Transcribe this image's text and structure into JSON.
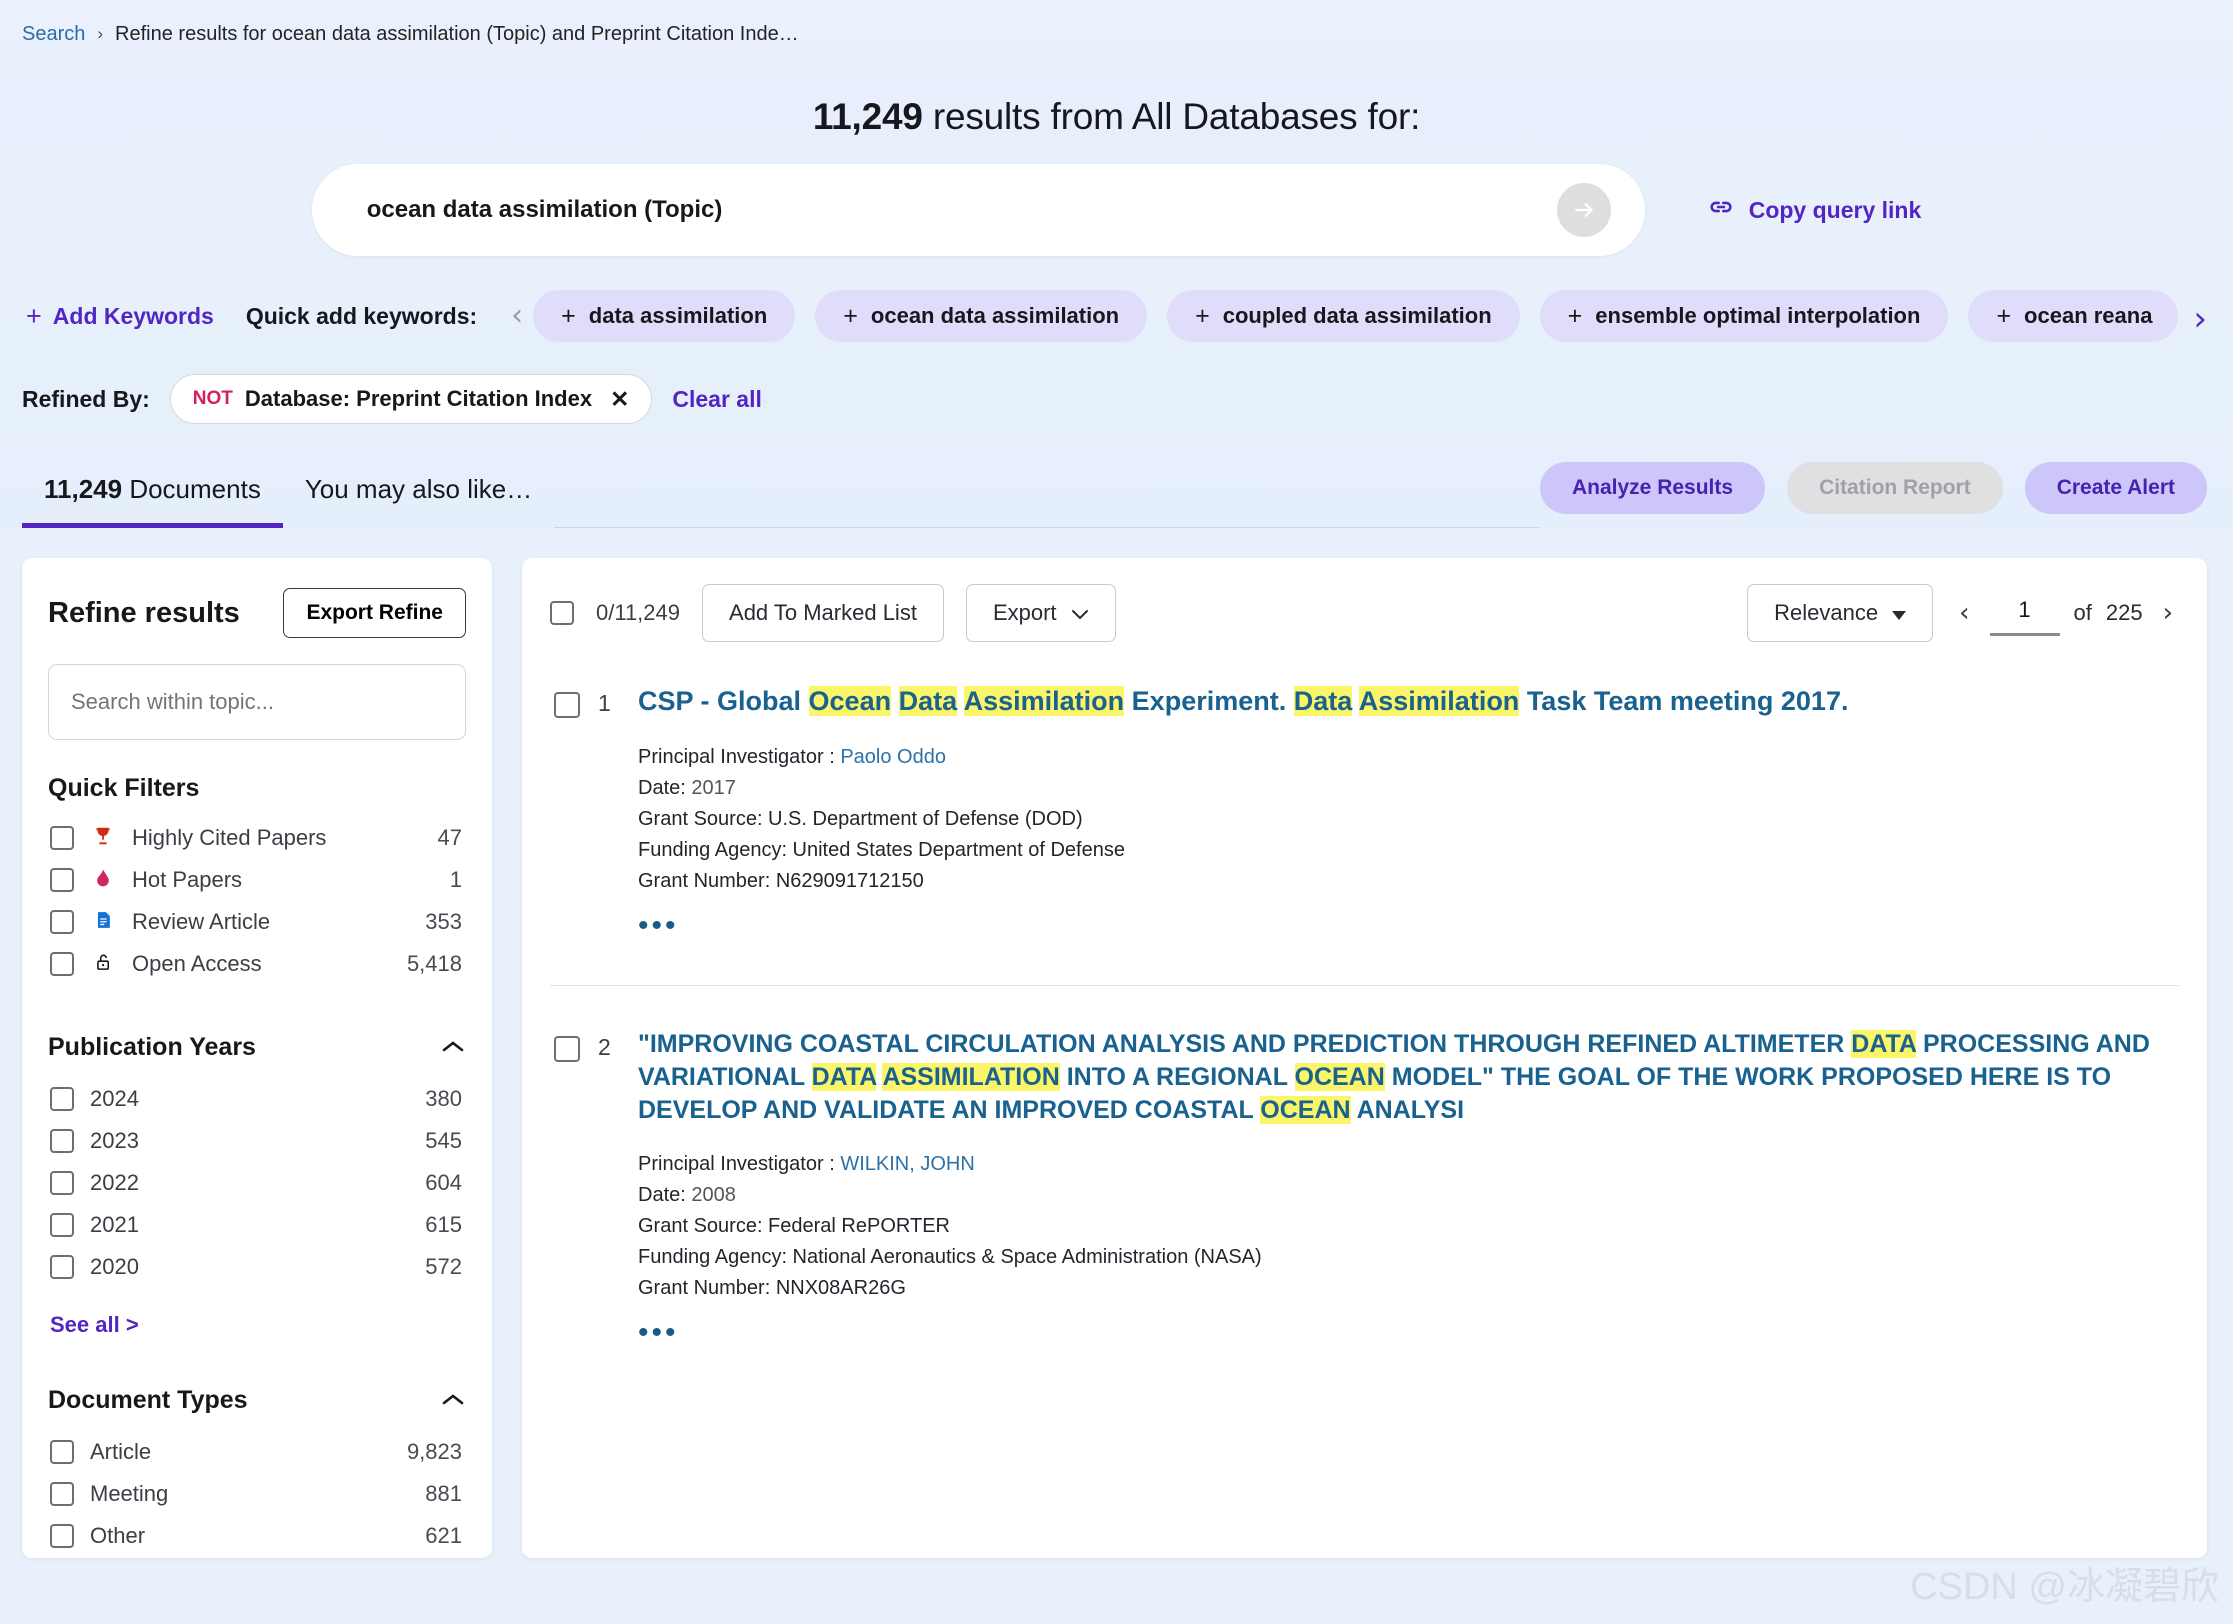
{
  "breadcrumb": {
    "root": "Search",
    "separator": "›",
    "current": "Refine results for ocean data assimilation (Topic) and Preprint Citation Inde…"
  },
  "hero": {
    "count": "11,249",
    "title_rest": " results from All Databases for:",
    "query": "ocean data assimilation (Topic)",
    "go_icon": "arrow-right-icon",
    "copy_query_link": "Copy query link",
    "link_icon": "link-icon"
  },
  "keywords": {
    "add_keywords": "Add Keywords",
    "quick_add_label": "Quick add keywords:",
    "prev_icon": "chevron-left-icon",
    "next_icon": "chevron-right-icon",
    "chips": [
      "data assimilation",
      "ocean data assimilation",
      "coupled data assimilation",
      "ensemble optimal interpolation",
      "ocean reana"
    ]
  },
  "refined": {
    "label": "Refined By:",
    "chip_not": "NOT",
    "chip_label": "Database: Preprint Citation Index",
    "chip_close": "✕",
    "clear_all": "Clear all"
  },
  "tabs": {
    "documents_count": "11,249",
    "documents_label": " Documents",
    "also_like": "You may also like…",
    "active_index": 0
  },
  "actions": {
    "analyze": "Analyze Results",
    "citation_report": "Citation Report",
    "create_alert": "Create Alert"
  },
  "sidebar": {
    "title": "Refine results",
    "export_refine": "Export Refine",
    "search_placeholder": "Search within topic...",
    "quick_filters_title": "Quick Filters",
    "quick_filters": [
      {
        "icon": "trophy-icon",
        "glyph": "\u0000",
        "label": "Highly Cited Papers",
        "count": "47"
      },
      {
        "icon": "flame-icon",
        "glyph": "\u0000",
        "label": "Hot Papers",
        "count": "1"
      },
      {
        "icon": "document-icon",
        "glyph": "\u0000",
        "label": "Review Article",
        "count": "353"
      },
      {
        "icon": "unlock-icon",
        "glyph": "\u0000",
        "label": "Open Access",
        "count": "5,418"
      }
    ],
    "publication_years": {
      "title": "Publication Years",
      "collapse_icon": "chevron-up-icon",
      "items": [
        {
          "label": "2024",
          "count": "380"
        },
        {
          "label": "2023",
          "count": "545"
        },
        {
          "label": "2022",
          "count": "604"
        },
        {
          "label": "2021",
          "count": "615"
        },
        {
          "label": "2020",
          "count": "572"
        }
      ],
      "see_all": "See all >"
    },
    "document_types": {
      "title": "Document Types",
      "collapse_icon": "chevron-up-icon",
      "items": [
        {
          "label": "Article",
          "count": "9,823"
        },
        {
          "label": "Meeting",
          "count": "881"
        },
        {
          "label": "Other",
          "count": "621"
        }
      ]
    }
  },
  "results_toolbar": {
    "select_count": "0/11,249",
    "add_to_marked_list": "Add To Marked List",
    "export": "Export",
    "export_caret": "chevron-down-icon",
    "sort_value": "Relevance",
    "sort_caret": "caret-down-icon",
    "prev_icon": "chevron-left-icon",
    "next_icon": "chevron-right-icon",
    "page_value": "1",
    "page_of": "of",
    "page_total": "225"
  },
  "records": [
    {
      "number": "1",
      "title_parts": [
        {
          "t": "CSP - Global ",
          "hl": false
        },
        {
          "t": "Ocean",
          "hl": true
        },
        {
          "t": " ",
          "hl": false
        },
        {
          "t": "Data",
          "hl": true
        },
        {
          "t": " ",
          "hl": false
        },
        {
          "t": "Assimilation",
          "hl": true
        },
        {
          "t": " Experiment. ",
          "hl": false
        },
        {
          "t": "Data",
          "hl": true
        },
        {
          "t": " ",
          "hl": false
        },
        {
          "t": "Assimilation",
          "hl": true
        },
        {
          "t": " Task Team meeting 2017.",
          "hl": false
        }
      ],
      "pi_label": "Principal Investigator : ",
      "pi_value": "Paolo Oddo",
      "date_label": "Date: ",
      "date_value": "2017",
      "grant_source": "Grant Source: U.S. Department of Defense (DOD)",
      "funding_agency": "Funding Agency: United States Department of Defense",
      "grant_number": "Grant Number: N629091712150",
      "more_icon": "more-horizontal-icon",
      "caps": false
    },
    {
      "number": "2",
      "title_parts": [
        {
          "t": "\"IMPROVING COASTAL CIRCULATION ANALYSIS AND PREDICTION THROUGH REFINED ALTIMETER ",
          "hl": false
        },
        {
          "t": "DATA",
          "hl": true
        },
        {
          "t": " PROCESSING AND VARIATIONAL ",
          "hl": false
        },
        {
          "t": "DATA",
          "hl": true
        },
        {
          "t": " ",
          "hl": false
        },
        {
          "t": "ASSIMILATION",
          "hl": true
        },
        {
          "t": " INTO A REGIONAL ",
          "hl": false
        },
        {
          "t": "OCEAN",
          "hl": true
        },
        {
          "t": " MODEL\" THE GOAL OF THE WORK PROPOSED HERE IS TO DEVELOP AND VALIDATE AN IMPROVED COASTAL ",
          "hl": false
        },
        {
          "t": "OCEAN",
          "hl": true
        },
        {
          "t": " ANALYSI",
          "hl": false
        }
      ],
      "pi_label": "Principal Investigator : ",
      "pi_value": "WILKIN, JOHN",
      "date_label": "Date: ",
      "date_value": "2008",
      "grant_source": "Grant Source: Federal RePORTER",
      "funding_agency": "Funding Agency: National Aeronautics & Space Administration (NASA)",
      "grant_number": "Grant Number: NNX08AR26G",
      "more_icon": "more-horizontal-icon",
      "caps": true
    }
  ],
  "watermark": "CSDN @冰凝碧欣",
  "colors": {
    "accent_purple": "#5326c4",
    "chip_purple": "#e0ddfb",
    "link_blue": "#19618f",
    "highlight_yellow": "#fbf56a",
    "not_red": "#d61f5c",
    "page_bg": "#e8f1fb"
  }
}
